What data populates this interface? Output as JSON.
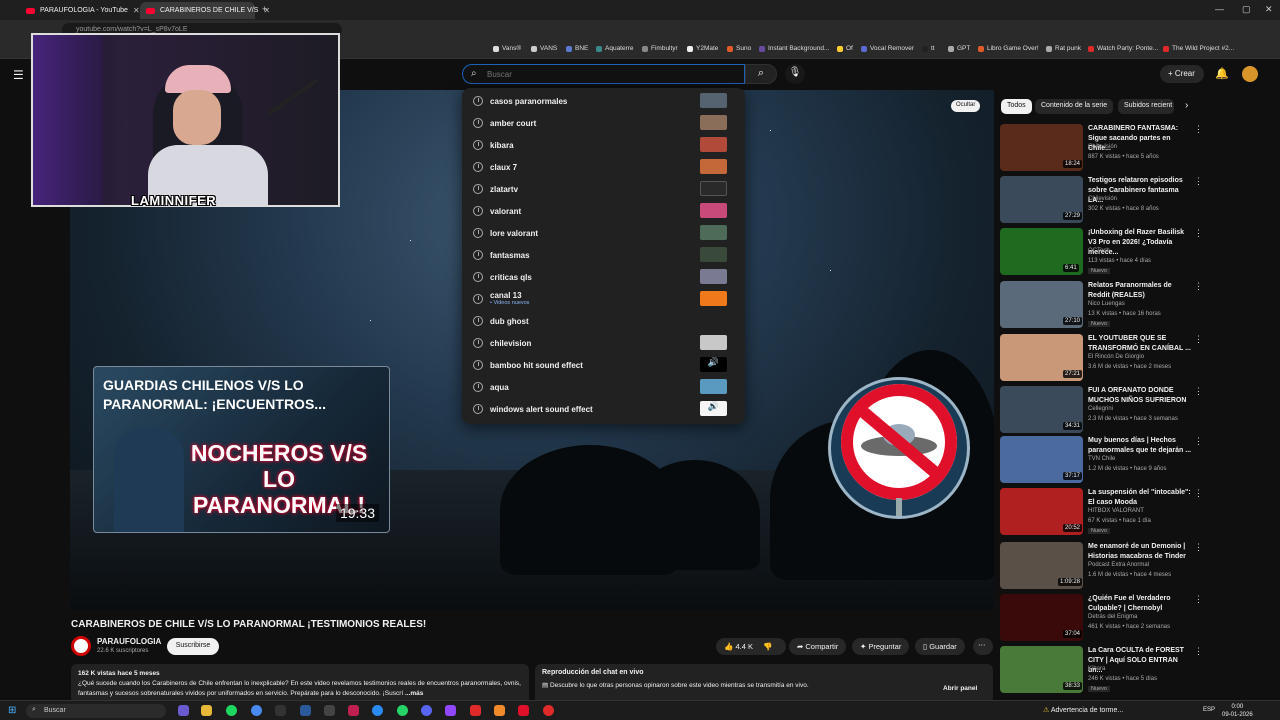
{
  "browser": {
    "tabs": [
      {
        "label": "PARAUFOLOGIA - YouTube",
        "active": false
      },
      {
        "label": "CARABINEROS DE CHILE V/S",
        "active": true
      }
    ],
    "url": "youtube.com/watch?v=L_sP8v7oLE",
    "bookmarks": [
      "Vans®",
      "VANS",
      "BNE",
      "Aquaterre",
      "Fimbultyr",
      "Y2Mate",
      "Suno",
      "Instant Background...",
      "Of",
      "Vocal Remover",
      "tt",
      "GPT",
      "Libro Game Over!",
      "Rat punk",
      "Watch Party: Ponte...",
      "The Wild Project #2..."
    ]
  },
  "youtube": {
    "search_placeholder": "Buscar",
    "create_label": "Crear",
    "suggestions": [
      {
        "label": "casos paranormales",
        "color": "#556270"
      },
      {
        "label": "amber court",
        "color": "#8a6e5a"
      },
      {
        "label": "kibara",
        "color": "#b24a3a"
      },
      {
        "label": "claux 7",
        "color": "#c4683a"
      },
      {
        "label": "zlatartv",
        "color": "#2a2a2a"
      },
      {
        "label": "valorant",
        "color": "#c84a7a"
      },
      {
        "label": "lore valorant",
        "color": "#4e6a58"
      },
      {
        "label": "fantasmas",
        "color": "#3a4a3a"
      },
      {
        "label": "criticas qls",
        "color": "#7a7a92"
      },
      {
        "label": "canal 13",
        "sub": "• Videos nuevos",
        "color": "#f07a1a"
      },
      {
        "label": "dub ghost",
        "color": ""
      },
      {
        "label": "chilevision",
        "color": "#c8c8c8"
      },
      {
        "label": "bamboo hit sound effect",
        "color": "#000000"
      },
      {
        "label": "aqua",
        "color": "#5a9ac0"
      },
      {
        "label": "windows alert sound effect",
        "color": "#f5f5f5"
      }
    ]
  },
  "video": {
    "thumb_title": "GUARDIAS CHILENOS V/S LO PARANORMAL: ¡ENCUENTROS...",
    "thumb_big": "NOCHEROS V/S LO PARANORMAL!",
    "thumb_duration": "19:33",
    "hide_label": "Ocultar",
    "webcam_tag": "LAMINNIFER",
    "title": "CARABINEROS DE CHILE V/S LO PARANORMAL ¡TESTIMONIOS REALES!",
    "channel": "PARAUFOLOGIA",
    "subscribers": "22.6 K suscriptores",
    "subscribe_label": "Suscribirse",
    "likes": "4.4 K",
    "share_label": "Compartir",
    "ask_label": "Preguntar",
    "save_label": "Guardar",
    "views_date": "162 K vistas  hace 5 meses",
    "description": "¿Qué sucede cuando los Carabineros de Chile enfrentan lo inexplicable? En este video revelamos testimonios reales de encuentros paranormales, ovnis, fantasmas y sucesos sobrenaturales vividos por uniformados en servicio. Prepárate para lo desconocido. ¡Suscrí",
    "more_label": "...más",
    "chat_title": "Reproducción del chat en vivo",
    "chat_text": "Descubre lo que otras personas opinaron sobre este video mientras se transmitía en vivo.",
    "chat_button": "Abrir panel"
  },
  "sidebar": {
    "chips": [
      "Todos",
      "Contenido de la serie",
      "Subidos recient"
    ],
    "videos": [
      {
        "title": "CARABINERO FANTASMA: Sigue sacando partes en Chile...",
        "channel": "Chilevisión",
        "meta": "887 K vistas • hace 5 años",
        "duration": "18:24",
        "color": "#5a2a1a",
        "badge": ""
      },
      {
        "title": "Testigos relataron episodios sobre Carabinero fantasma LA...",
        "channel": "Chilevisión",
        "meta": "302 K vistas • hace 8 años",
        "duration": "27:29",
        "color": "#3a4a5a",
        "badge": ""
      },
      {
        "title": "¡Unboxing del Razer Basilisk V3 Pro en 2026! ¿Todavía merece...",
        "channel": "OCTech",
        "meta": "113 vistas • hace 4 días",
        "duration": "6:41",
        "color": "#1e6a1e",
        "badge": "Nuevo"
      },
      {
        "title": "Relatos Paranormales de Reddit (REALES)",
        "channel": "Nico Luengas",
        "meta": "13 K vistas • hace 16 horas",
        "duration": "27:10",
        "color": "#5a6a7a",
        "badge": "Nuevo"
      },
      {
        "title": "EL YOUTUBER QUE SE TRANSFORMÓ EN CANÍBAL ...",
        "channel": "El Rincón De Giorgio",
        "meta": "3.6 M de vistas • hace 2 meses",
        "duration": "27:21",
        "color": "#c89878",
        "badge": ""
      },
      {
        "title": "FUI A ORFANATO DONDE MUCHOS NIÑOS SUFRIERON",
        "channel": "Cellegrini",
        "meta": "2.3 M de vistas • hace 3 semanas",
        "duration": "34:31",
        "color": "#3a4a5a",
        "badge": ""
      },
      {
        "title": "Muy buenos días | Hechos paranormales que te dejarán ...",
        "channel": "TVN Chile",
        "meta": "1.2 M de vistas • hace 9 años",
        "duration": "37:17",
        "color": "#4a6aa0",
        "badge": ""
      },
      {
        "title": "La suspensión del \"intocable\": El caso Mooda",
        "channel": "HITBOX VALORANT",
        "meta": "67 K vistas • hace 1 día",
        "duration": "20:52",
        "color": "#b02020",
        "badge": "Nuevo"
      },
      {
        "title": "Me enamoré de un Demonio | Historias macabras de Tinder",
        "channel": "Podcast Extra Anormal",
        "meta": "1.6 M de vistas • hace 4 meses",
        "duration": "1:09:28",
        "color": "#5a5048",
        "badge": ""
      },
      {
        "title": "¿Quién Fue el Verdadero Culpable? | Chernobyl",
        "channel": "Detrás del Enigma",
        "meta": "461 K vistas • hace 2 semanas",
        "duration": "37:04",
        "color": "#3a0a0a",
        "badge": ""
      },
      {
        "title": "La Cara OCULTA de FOREST CITY | Aquí SOLO ENTRAN un...",
        "channel": "Kibara",
        "meta": "246 K vistas • hace 5 días",
        "duration": "38:33",
        "color": "#4a7a3a",
        "badge": "Nuevo"
      }
    ]
  },
  "taskbar": {
    "search_label": "Buscar",
    "weather": "Advertencia de torme...",
    "lang": "ESP",
    "time": "0:00",
    "date": "09-01-2026"
  }
}
